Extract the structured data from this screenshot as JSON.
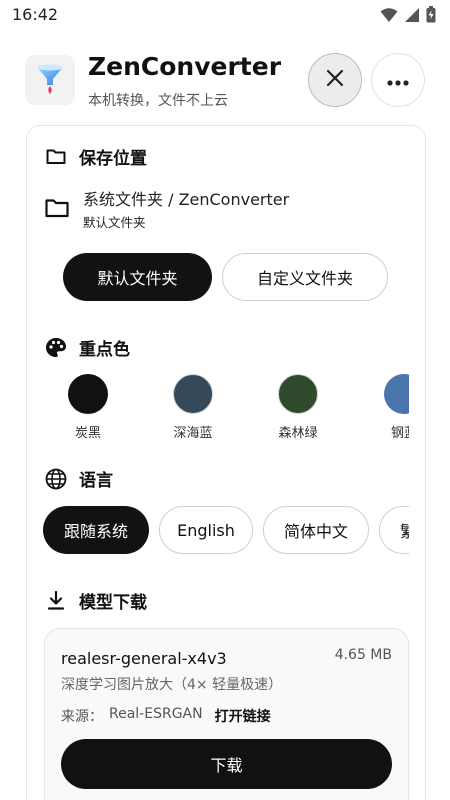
{
  "status_bar": {
    "time": "16:42",
    "icons": [
      "wifi-icon",
      "signal-icon",
      "battery-icon"
    ]
  },
  "app": {
    "title": "ZenConverter",
    "subtitle": "本机转换，文件不上云",
    "logo_icon": "funnel-logo-icon",
    "close_icon": "close-icon",
    "more_icon": "more-horizontal-icon"
  },
  "save_location": {
    "title": "保存位置",
    "icon": "folder-icon",
    "path": "系统文件夹 / ZenConverter",
    "path_sub": "默认文件夹",
    "options": [
      {
        "label": "默认文件夹",
        "selected": true
      },
      {
        "label": "自定义文件夹",
        "selected": false
      }
    ]
  },
  "accent_color": {
    "title": "重点色",
    "icon": "palette-icon",
    "swatches": [
      {
        "label": "炭黑",
        "color": "#111111",
        "selected": true
      },
      {
        "label": "深海蓝",
        "color": "#34495a",
        "selected": false
      },
      {
        "label": "森林绿",
        "color": "#2e4b2e",
        "selected": false
      },
      {
        "label": "钢蓝",
        "color": "#4a75ad",
        "selected": false
      }
    ]
  },
  "language": {
    "title": "语言",
    "icon": "globe-icon",
    "options": [
      {
        "label": "跟随系统",
        "selected": true
      },
      {
        "label": "English",
        "selected": false
      },
      {
        "label": "简体中文",
        "selected": false
      },
      {
        "label": "繁體中文",
        "selected": false
      }
    ]
  },
  "model_download": {
    "title": "模型下载",
    "icon": "download-icon",
    "model": {
      "name": "realesr-general-x4v3",
      "size": "4.65 MB",
      "description": "深度学习图片放大（4× 轻量极速）",
      "source_label": "来源：",
      "source_name": "Real-ESRGAN",
      "source_link": "打开链接",
      "download_label": "下载"
    }
  }
}
